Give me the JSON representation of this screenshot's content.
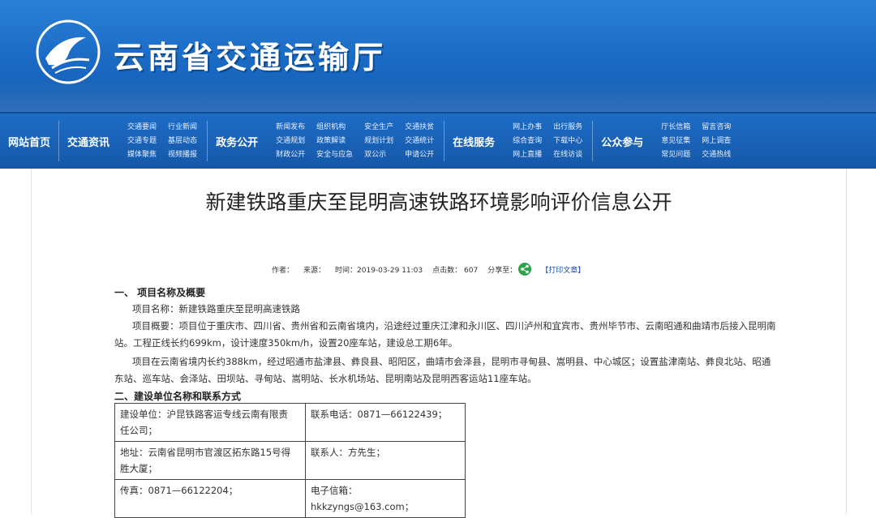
{
  "header": {
    "site_title": "云南省交通运输厅",
    "brand_color": "#1a6ac4"
  },
  "nav": {
    "home": "网站首页",
    "news": "交通资讯",
    "news_sub": [
      "交通要闻",
      "交通专题",
      "媒体聚焦",
      "行业新闻",
      "基层动态",
      "视频播报"
    ],
    "gov": "政务公开",
    "gov_sub": [
      "新闻发布",
      "交通规划",
      "财政公开",
      "组织机构",
      "政策解读",
      "安全与应急",
      "安全生产",
      "规划计划",
      "双公示",
      "交通扶贫",
      "交通统计",
      "申请公开"
    ],
    "online": "在线服务",
    "online_sub": [
      "网上办事",
      "综合查询",
      "网上直播",
      "出行服务",
      "下载中心",
      "在线访谈"
    ],
    "public": "公众参与",
    "public_sub": [
      "厅长信箱",
      "意见征集",
      "常见问题",
      "留言咨询",
      "网上调查",
      "交通热线"
    ]
  },
  "article": {
    "title": "新建铁路重庆至昆明高速铁路环境影响评价信息公开",
    "meta": {
      "author": "作者：",
      "source": "来源：",
      "time": "时间：2019-03-29 11:03",
      "clicks": "点击数：  607",
      "share": "分享至：",
      "print": "【打印文章】",
      "share_color": "#2ca24a"
    },
    "sec1_heading": "一、 项目名称及概要",
    "project_name": "项目名称：新建铁路重庆至昆明高速铁路",
    "overview_line1": "项目概要：项目位于重庆市、四川省、贵州省和云南省境内，沿途经过重庆江津和永川区、四川泸州和宜宾市、贵州毕节市、云南昭通和曲靖市后接入昆明南",
    "overview_line2": "站。工程正线长约699km，设计速度350km/h，设置20座车站，建设总工期6年。",
    "yunnan_line1": "项目在云南省境内长约388km，经过昭通市盐津县、彝良县、昭阳区，曲靖市会泽县，昆明市寻甸县、嵩明县、中心城区；设置盐津南站、彝良北站、昭通",
    "yunnan_line2": "东站、巡车站、会泽站、田坝站、寻甸站、嵩明站、长水机场站、昆明南站及昆明西客运站11座车站。",
    "sec2_heading": "二、建设单位名称和联系方式",
    "contact": {
      "unit_line1": "建设单位：沪昆铁路客运专线云南有限责",
      "unit_line2": "任公司；",
      "phone": "联系电话：0871—66122439；",
      "addr_line1": "地址：云南省昆明市官渡区拓东路15号得",
      "addr_line2": "胜大厦；",
      "person": "联系人：方先生；",
      "fax": "传真：0871—66122204；",
      "email_label": "电子信箱：",
      "email": "hkkzyngs@163.com；"
    }
  }
}
